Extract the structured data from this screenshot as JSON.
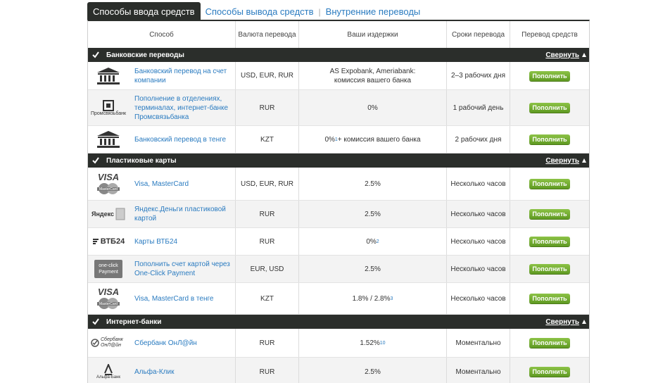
{
  "tabs": {
    "active": "Способы ввода средств",
    "withdraw": "Способы вывода средств",
    "separator": "|",
    "internal": "Внутренние переводы"
  },
  "columns": {
    "method": "Способ",
    "currency": "Валюта перевода",
    "fees": "Ваши издержки",
    "terms": "Сроки перевода",
    "transfer": "Перевод средств"
  },
  "collapse_label": "Свернуть",
  "button_label": "Пополнить",
  "sections": [
    {
      "title": "Банковские переводы",
      "rows": [
        {
          "icon": "bank-building-icon",
          "name": "Банковский перевод на счет компании",
          "currency": "USD, EUR, RUR",
          "fee": "AS Expobank, Ameriabank: комиссия вашего банка",
          "fee_sup": "",
          "term": "2–3 рабочих дня"
        },
        {
          "icon": "promsvyazbank-logo-icon",
          "logo_text": "Промсвязьбанк",
          "name": "Пополнение в отделениях, терминалах, интернет-банке Промсвязьбанка",
          "currency": "RUR",
          "fee": "0%",
          "fee_sup": "",
          "term": "1 рабочий день"
        },
        {
          "icon": "bank-building-icon",
          "name": "Банковский перевод в тенге",
          "currency": "KZT",
          "fee": "0%",
          "fee_sup": "1",
          "fee_suffix": " + комиссия вашего банка",
          "term": "2 рабочих дня"
        }
      ]
    },
    {
      "title": "Пластиковые карты",
      "rows": [
        {
          "icon": "visa-mastercard-icon",
          "name": "Visa, MasterCard",
          "currency": "USD, EUR, RUR",
          "fee": "2.5%",
          "fee_sup": "",
          "term": "Несколько часов"
        },
        {
          "icon": "yandex-money-icon",
          "logo_text": "Яндекс",
          "name": "Яндекс.Деньги пластиковой картой",
          "currency": "RUR",
          "fee": "2.5%",
          "fee_sup": "",
          "term": "Несколько часов"
        },
        {
          "icon": "vtb24-logo-icon",
          "logo_text": "ВТБ24",
          "name": "Карты ВТБ24",
          "currency": "RUR",
          "fee": "0%",
          "fee_sup": "2",
          "term": "Несколько часов"
        },
        {
          "icon": "one-click-payment-icon",
          "logo_text": "one-click Payment",
          "name": "Пополнить счет картой через One-Click Payment",
          "currency": "EUR, USD",
          "fee": "2.5%",
          "fee_sup": "",
          "term": "Несколько часов"
        },
        {
          "icon": "visa-mastercard-icon",
          "name": "Visa, MasterCard в тенге",
          "currency": "KZT",
          "fee": "1.8% / 2.8%",
          "fee_sup": "3",
          "term": "Несколько часов"
        }
      ]
    },
    {
      "title": "Интернет-банки",
      "rows": [
        {
          "icon": "sberbank-online-icon",
          "logo_text": "Сбербанк ОнЛ@йн",
          "name": "Сбербанк ОнЛ@йн",
          "currency": "RUR",
          "fee": "1.52%",
          "fee_sup": "10",
          "term": "Моментально"
        },
        {
          "icon": "alfa-bank-icon",
          "logo_text": "Альфа-Банк",
          "name": "Альфа-Клик",
          "currency": "RUR",
          "fee": "2.5%",
          "fee_sup": "",
          "term": "Моментально"
        }
      ]
    }
  ],
  "colors": {
    "dark": "#2b2e2b",
    "link": "#2a7bc0",
    "button": "#6fa92d"
  }
}
